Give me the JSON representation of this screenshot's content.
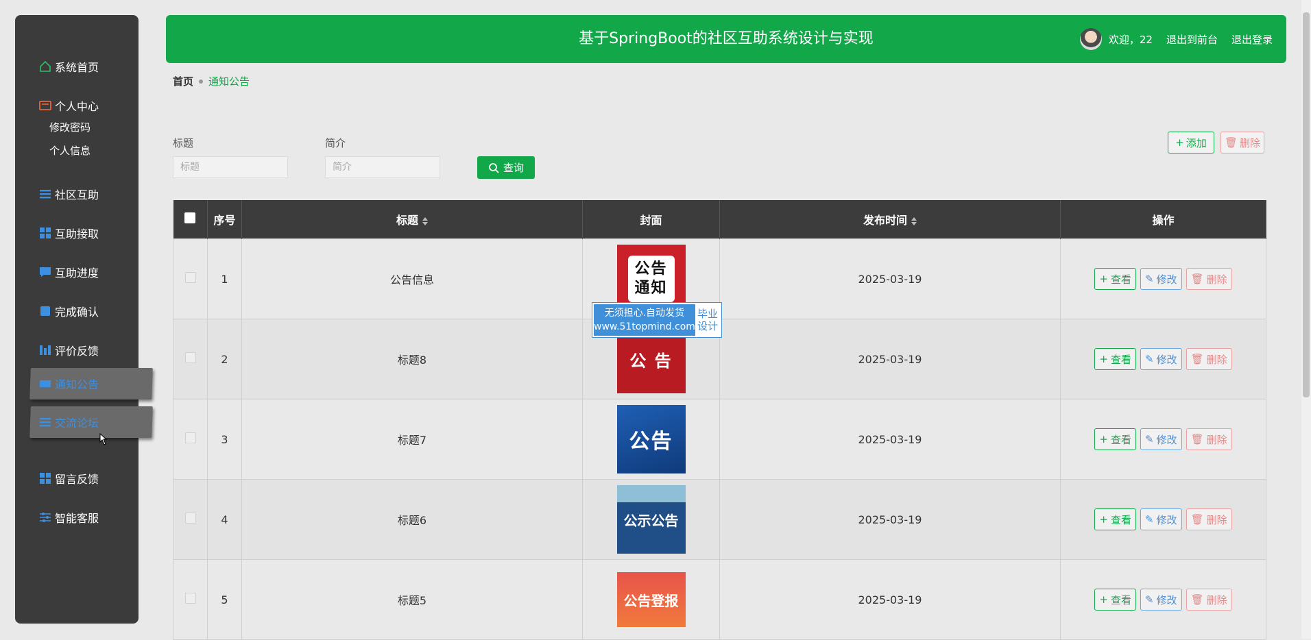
{
  "sidebar": {
    "items": [
      {
        "label": "系统首页",
        "icon": "home-icon"
      },
      {
        "label": "个人中心",
        "icon": "user-card-icon"
      },
      {
        "label": "社区互助",
        "icon": "list-icon"
      },
      {
        "label": "互助接取",
        "icon": "grid-icon"
      },
      {
        "label": "互助进度",
        "icon": "chat-icon"
      },
      {
        "label": "完成确认",
        "icon": "folder-icon"
      },
      {
        "label": "评价反馈",
        "icon": "bar-chart-icon"
      },
      {
        "label": "通知公告",
        "icon": "ticket-icon"
      },
      {
        "label": "交流论坛",
        "icon": "list-icon"
      },
      {
        "label": "留言反馈",
        "icon": "grid-icon"
      },
      {
        "label": "智能客服",
        "icon": "sliders-icon"
      }
    ],
    "sub_items": [
      "修改密码",
      "个人信息"
    ]
  },
  "header": {
    "title": "基于SpringBoot的社区互助系统设计与实现",
    "welcome": "欢迎，22",
    "to_front": "退出到前台",
    "logout": "退出登录"
  },
  "breadcrumb": {
    "home": "首页",
    "current": "通知公告"
  },
  "search": {
    "title_label": "标题",
    "title_placeholder": "标题",
    "intro_label": "简介",
    "intro_placeholder": "简介",
    "query_label": "查询"
  },
  "toolbar": {
    "add_label": "添加",
    "delete_label": "删除"
  },
  "table": {
    "headers": [
      "序号",
      "标题",
      "封面",
      "发布时间",
      "操作"
    ],
    "rows": [
      {
        "index": "1",
        "title": "公告信息",
        "cover": "公告通知",
        "date": "2025-03-19"
      },
      {
        "index": "2",
        "title": "标题8",
        "cover": "公 告",
        "date": "2025-03-19"
      },
      {
        "index": "3",
        "title": "标题7",
        "cover": "公告",
        "date": "2025-03-19"
      },
      {
        "index": "4",
        "title": "标题6",
        "cover": "公示公告",
        "date": "2025-03-19"
      },
      {
        "index": "5",
        "title": "标题5",
        "cover": "公告登报",
        "date": "2025-03-19"
      }
    ],
    "actions": {
      "view": "查看",
      "edit": "修改",
      "delete": "删除"
    }
  },
  "watermark": {
    "line1": "无须担心.自动发货",
    "line2": "www.51topmind.com",
    "tag1": "毕业",
    "tag2": "设计"
  },
  "colors": {
    "primary": "#12a84a",
    "sidebar": "#3b3b3b",
    "active_text": "#3d8fe0",
    "danger": "#e08a8a"
  }
}
